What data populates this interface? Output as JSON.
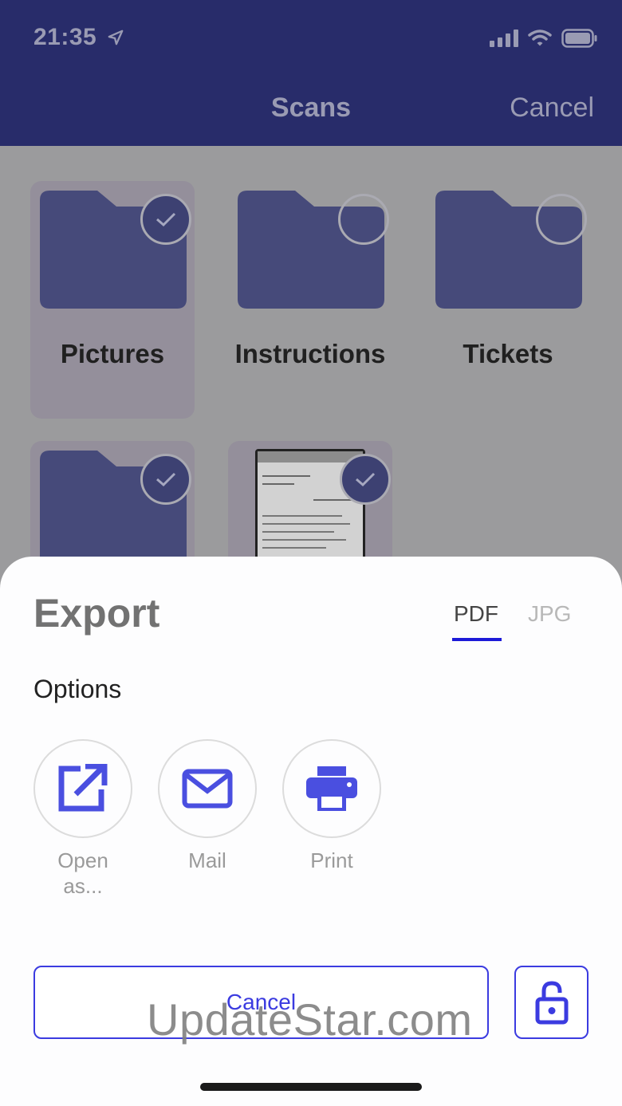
{
  "status_bar": {
    "time": "21:35"
  },
  "header": {
    "title": "Scans",
    "cancel_label": "Cancel"
  },
  "grid": {
    "items": [
      {
        "label": "Pictures",
        "selected": true,
        "kind": "folder"
      },
      {
        "label": "Instructions",
        "selected": false,
        "kind": "folder"
      },
      {
        "label": "Tickets",
        "selected": false,
        "kind": "folder"
      },
      {
        "label": "",
        "selected": true,
        "kind": "folder"
      },
      {
        "label": "",
        "selected": true,
        "kind": "document"
      }
    ]
  },
  "sheet": {
    "title": "Export",
    "tabs": [
      {
        "label": "PDF",
        "active": true
      },
      {
        "label": "JPG",
        "active": false
      }
    ],
    "options_label": "Options",
    "options": [
      {
        "label": "Open as...",
        "icon": "open-external-icon"
      },
      {
        "label": "Mail",
        "icon": "mail-icon"
      },
      {
        "label": "Print",
        "icon": "printer-icon"
      }
    ],
    "cancel_label": "Cancel",
    "lock_icon": "unlock-icon"
  },
  "watermark": "UpdateStar.com",
  "colors": {
    "accent": "#3b3be0",
    "header_bg": "#282c6a",
    "icon_blue": "#4a4fe0"
  }
}
